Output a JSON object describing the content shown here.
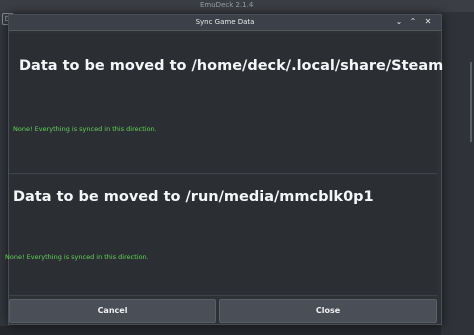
{
  "background_app": {
    "title": "EmuDeck 2.1.4",
    "icon_glyph": "⊡"
  },
  "dialog": {
    "title": "Sync Game Data",
    "controls": {
      "minimize": "⌄",
      "maximize": "⌃",
      "close": "✕"
    },
    "sections": [
      {
        "heading": "Data to be moved to /home/deck/.local/share/Steam",
        "status": "None! Everything is synced in this direction."
      },
      {
        "heading": "Data to be moved to /run/media/mmcblk0p1",
        "status": "None! Everything is synced in this direction."
      }
    ],
    "buttons": {
      "cancel": "Cancel",
      "close": "Close"
    }
  },
  "colors": {
    "status_green": "#63d35a",
    "dialog_bg": "#2e3136",
    "button_bg": "#4a4e56"
  }
}
